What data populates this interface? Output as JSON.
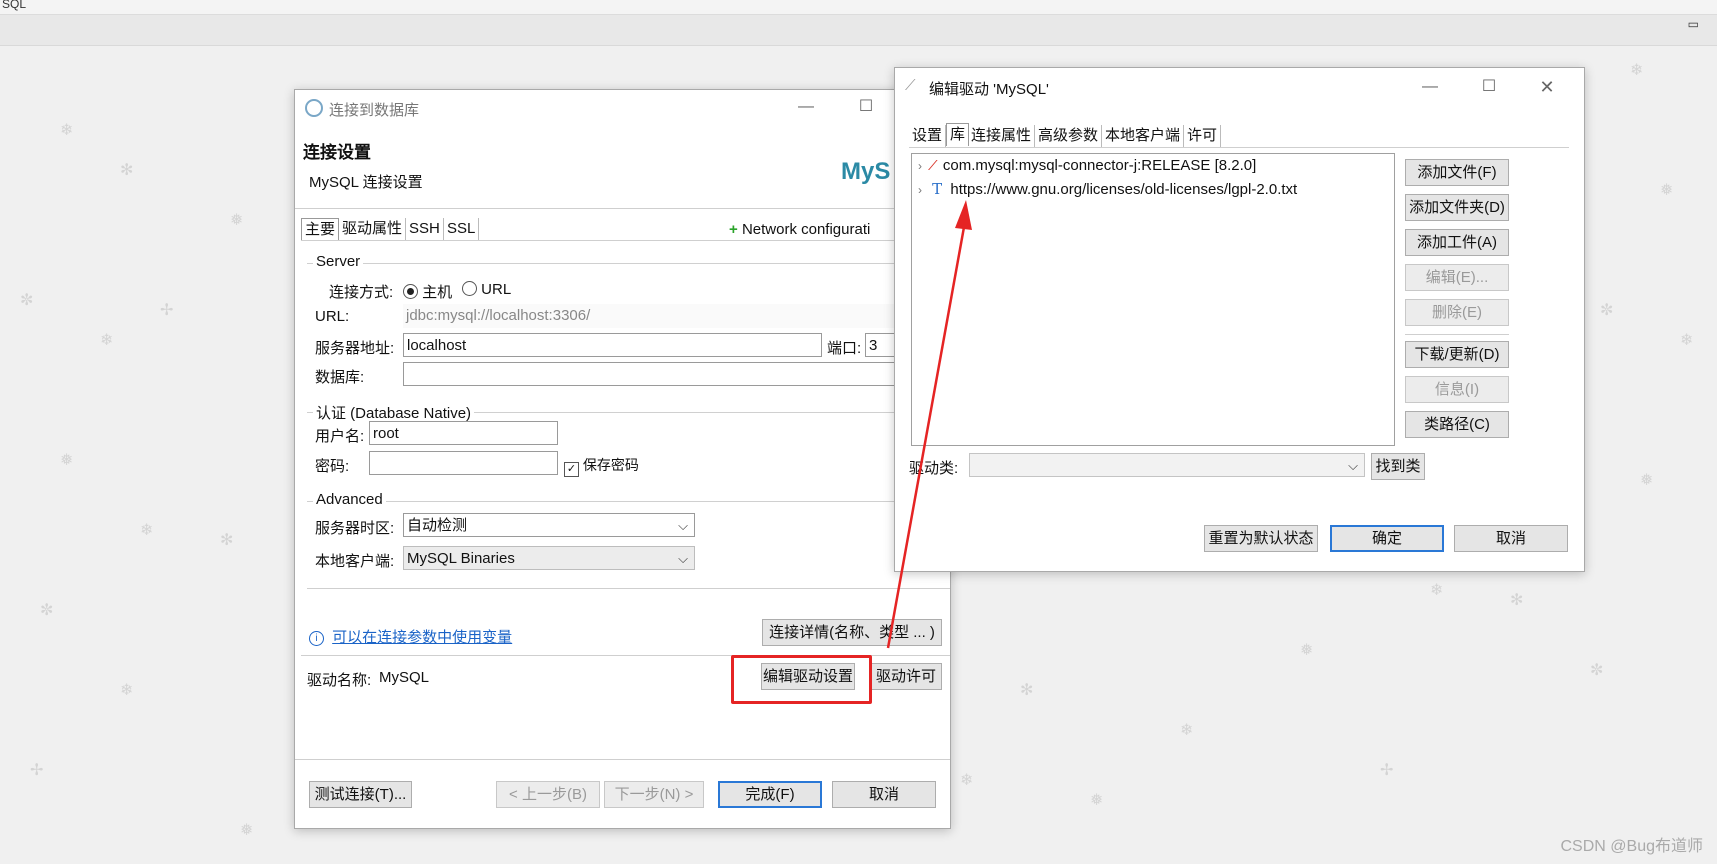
{
  "topbar": {
    "app_label": "SQL"
  },
  "connect_dialog": {
    "title": "连接到数据库",
    "header_title": "连接设置",
    "header_subtitle": "MySQL 连接设置",
    "logo_text": "MyS",
    "tabs": [
      "主要",
      "驱动属性",
      "SSH",
      "SSL"
    ],
    "network_config": "Network configurati",
    "server_group": "Server",
    "connect_method_label": "连接方式:",
    "radio_host": "主机",
    "radio_url": "URL",
    "url_label": "URL:",
    "url_value": "jdbc:mysql://localhost:3306/",
    "server_addr_label": "服务器地址:",
    "server_addr_value": "localhost",
    "port_label": "端口:",
    "port_value": "3",
    "database_label": "数据库:",
    "database_value": "",
    "auth_group": "认证 (Database Native)",
    "username_label": "用户名:",
    "username_value": "root",
    "password_label": "密码:",
    "password_value": "",
    "save_password": "保存密码",
    "advanced_group": "Advanced",
    "timezone_label": "服务器时区:",
    "timezone_value": "自动检测",
    "local_client_label": "本地客户端:",
    "local_client_value": "MySQL Binaries",
    "variables_link": "可以在连接参数中使用变量",
    "connection_details_button": "连接详情(名称、类型 ... )",
    "driver_name_label": "驱动名称:",
    "driver_name_value": "MySQL",
    "edit_driver_button": "编辑驱动设置",
    "driver_license_button": "驱动许可",
    "test_connection_button": "测试连接(T)...",
    "back_button": "< 上一步(B)",
    "next_button": "下一步(N) >",
    "finish_button": "完成(F)",
    "cancel_button": "取消"
  },
  "driver_dialog": {
    "title": "编辑驱动 'MySQL'",
    "tabs": [
      "设置",
      "库",
      "连接属性",
      "高级参数",
      "本地客户端",
      "许可"
    ],
    "libraries": [
      {
        "icon": "maven-feather-icon",
        "text": "com.mysql:mysql-connector-j:RELEASE [8.2.0]"
      },
      {
        "icon": "text-file-icon",
        "text": "https://www.gnu.org/licenses/old-licenses/lgpl-2.0.txt"
      }
    ],
    "side_buttons": [
      {
        "label": "添加文件(F)",
        "enabled": true
      },
      {
        "label": "添加文件夹(D)",
        "enabled": true
      },
      {
        "label": "添加工件(A)",
        "enabled": true
      },
      {
        "label": "编辑(E)...",
        "enabled": false
      },
      {
        "label": "删除(E)",
        "enabled": false
      },
      {
        "label": "下载/更新(D)",
        "enabled": true
      },
      {
        "label": "信息(I)",
        "enabled": false
      },
      {
        "label": "类路径(C)",
        "enabled": true
      }
    ],
    "driver_class_label": "驱动类:",
    "driver_class_value": "",
    "find_class_button": "找到类",
    "reset_default_button": "重置为默认状态",
    "ok_button": "确定",
    "cancel_button": "取消"
  },
  "annotation_color": "#e52424",
  "watermark": "CSDN @Bug布道师"
}
